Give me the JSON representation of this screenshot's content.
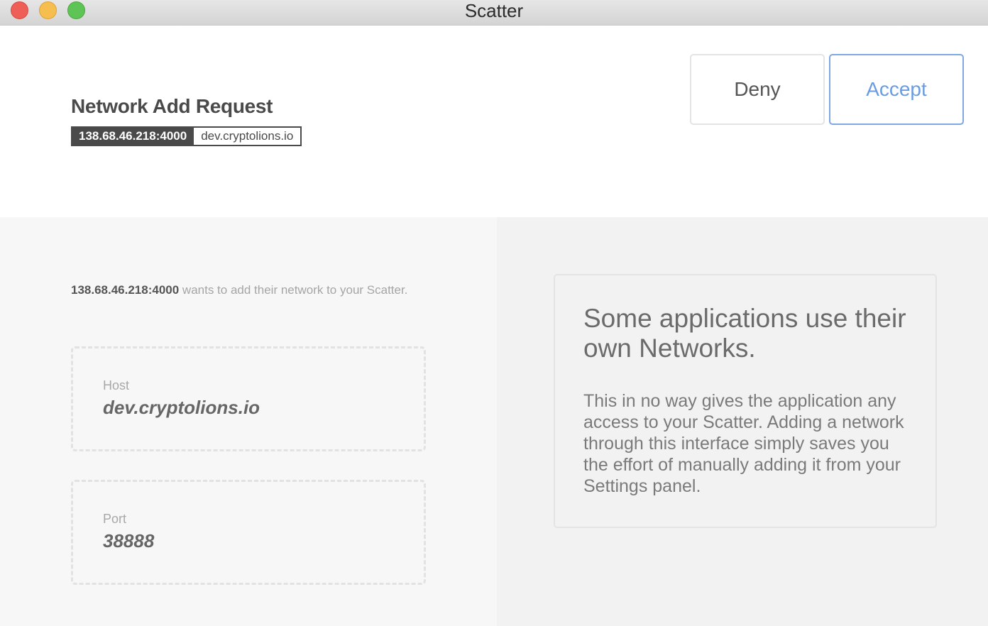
{
  "window": {
    "title": "Scatter"
  },
  "header": {
    "title": "Network Add Request",
    "network_ip": "138.68.46.218:4000",
    "network_host": "dev.cryptolions.io",
    "deny_label": "Deny",
    "accept_label": "Accept"
  },
  "request": {
    "origin": "138.68.46.218:4000",
    "message": " wants to add their network to your Scatter.",
    "fields": [
      {
        "label": "Host",
        "value": "dev.cryptolions.io"
      },
      {
        "label": "Port",
        "value": "38888"
      }
    ]
  },
  "info": {
    "heading": "Some applications use their own Networks.",
    "body": "This in no way gives the application any access to your Scatter. Adding a network through this interface simply saves you the effort of manually adding it from your Settings panel."
  },
  "colors": {
    "accent": "#6b9ce0",
    "tag_dark": "#4a4a4a",
    "close": "#ee5f57",
    "minimize": "#f5be4f",
    "maximize": "#5fc456"
  }
}
